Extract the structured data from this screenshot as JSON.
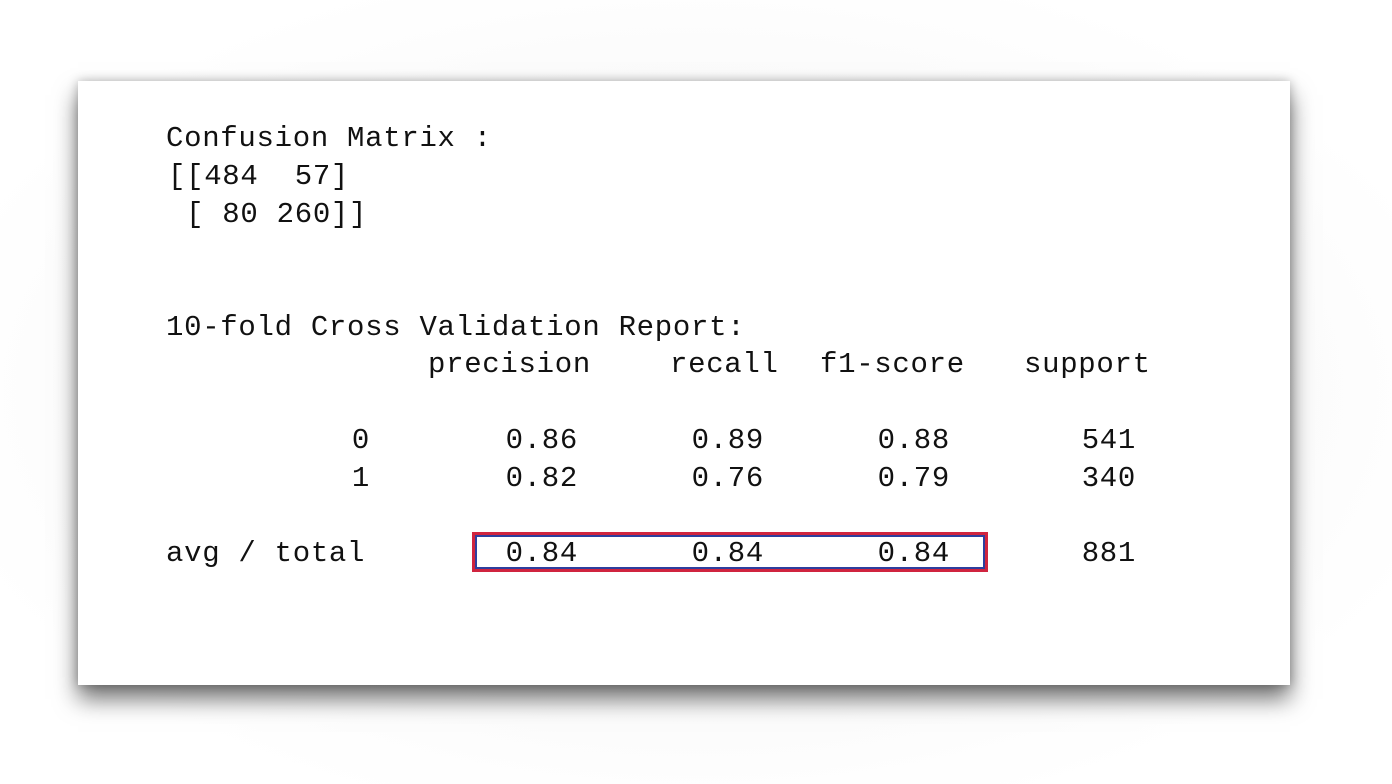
{
  "confusion": {
    "title": "Confusion Matrix :",
    "rows": [
      "[[484  57]",
      " [ 80 260]]"
    ]
  },
  "report": {
    "title": "10-fold Cross Validation Report:",
    "headers": {
      "precision": "precision",
      "recall": "recall",
      "f1": "f1-score",
      "support": "support"
    },
    "rows": [
      {
        "label": "0",
        "precision": "0.86",
        "recall": "0.89",
        "f1": "0.88",
        "support": "541"
      },
      {
        "label": "1",
        "precision": "0.82",
        "recall": "0.76",
        "f1": "0.79",
        "support": "340"
      }
    ],
    "total": {
      "label": "avg / total",
      "precision": "0.84",
      "recall": "0.84",
      "f1": "0.84",
      "support": "881"
    }
  },
  "colors": {
    "highlight_outer": "#d0243f",
    "highlight_inner": "#2e3f9e",
    "text": "#111111"
  }
}
